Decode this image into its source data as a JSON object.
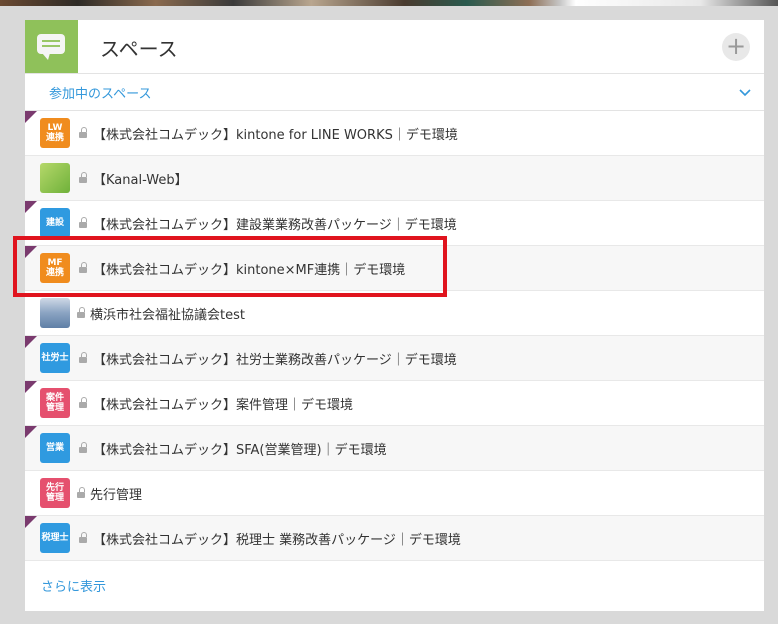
{
  "panel": {
    "title": "スペース",
    "add_symbol": "+",
    "subheader": "参加中のスペース",
    "more_link": "さらに表示"
  },
  "spaces": [
    {
      "name": "【株式会社コムデック】kintone for LINE WORKS｜デモ環境",
      "icon_text": "LW\n連携",
      "icon_color": "#f08c1e",
      "corner": true,
      "locked": true
    },
    {
      "name": "【Kanal-Web】",
      "icon_text": "",
      "icon_color": "#8fc73e",
      "corner": false,
      "locked": true
    },
    {
      "name": "【株式会社コムデック】建設業業務改善パッケージ｜デモ環境",
      "icon_text": "建設",
      "icon_color": "#2f9ae0",
      "corner": true,
      "locked": true
    },
    {
      "name": "【株式会社コムデック】kintone×MF連携｜デモ環境",
      "icon_text": "MF\n連携",
      "icon_color": "#f08c1e",
      "corner": true,
      "locked": true
    },
    {
      "name": "横浜市社会福祉協議会test",
      "icon_text": "",
      "icon_color": "#6d8fb8",
      "corner": false,
      "locked": true
    },
    {
      "name": "【株式会社コムデック】社労士業務改善パッケージ｜デモ環境",
      "icon_text": "社労士",
      "icon_color": "#2f9ae0",
      "corner": true,
      "locked": true
    },
    {
      "name": "【株式会社コムデック】案件管理｜デモ環境",
      "icon_text": "案件\n管理",
      "icon_color": "#e5506e",
      "corner": true,
      "locked": true
    },
    {
      "name": "【株式会社コムデック】SFA(営業管理)｜デモ環境",
      "icon_text": "営業",
      "icon_color": "#2f9ae0",
      "corner": true,
      "locked": true
    },
    {
      "name": "先行管理",
      "icon_text": "先行\n管理",
      "icon_color": "#e5506e",
      "corner": false,
      "locked": true
    },
    {
      "name": "【株式会社コムデック】税理士 業務改善パッケージ｜デモ環境",
      "icon_text": "税理士",
      "icon_color": "#2f9ae0",
      "corner": true,
      "locked": true
    }
  ],
  "colors": {
    "accent_link": "#3498db",
    "highlight_border": "#e0141e",
    "header_icon_bg": "#8fc15a"
  },
  "icons": {
    "header": "speech-bubble-icon",
    "add": "plus-icon",
    "expand": "chevron-down-icon",
    "lock": "lock-icon"
  }
}
